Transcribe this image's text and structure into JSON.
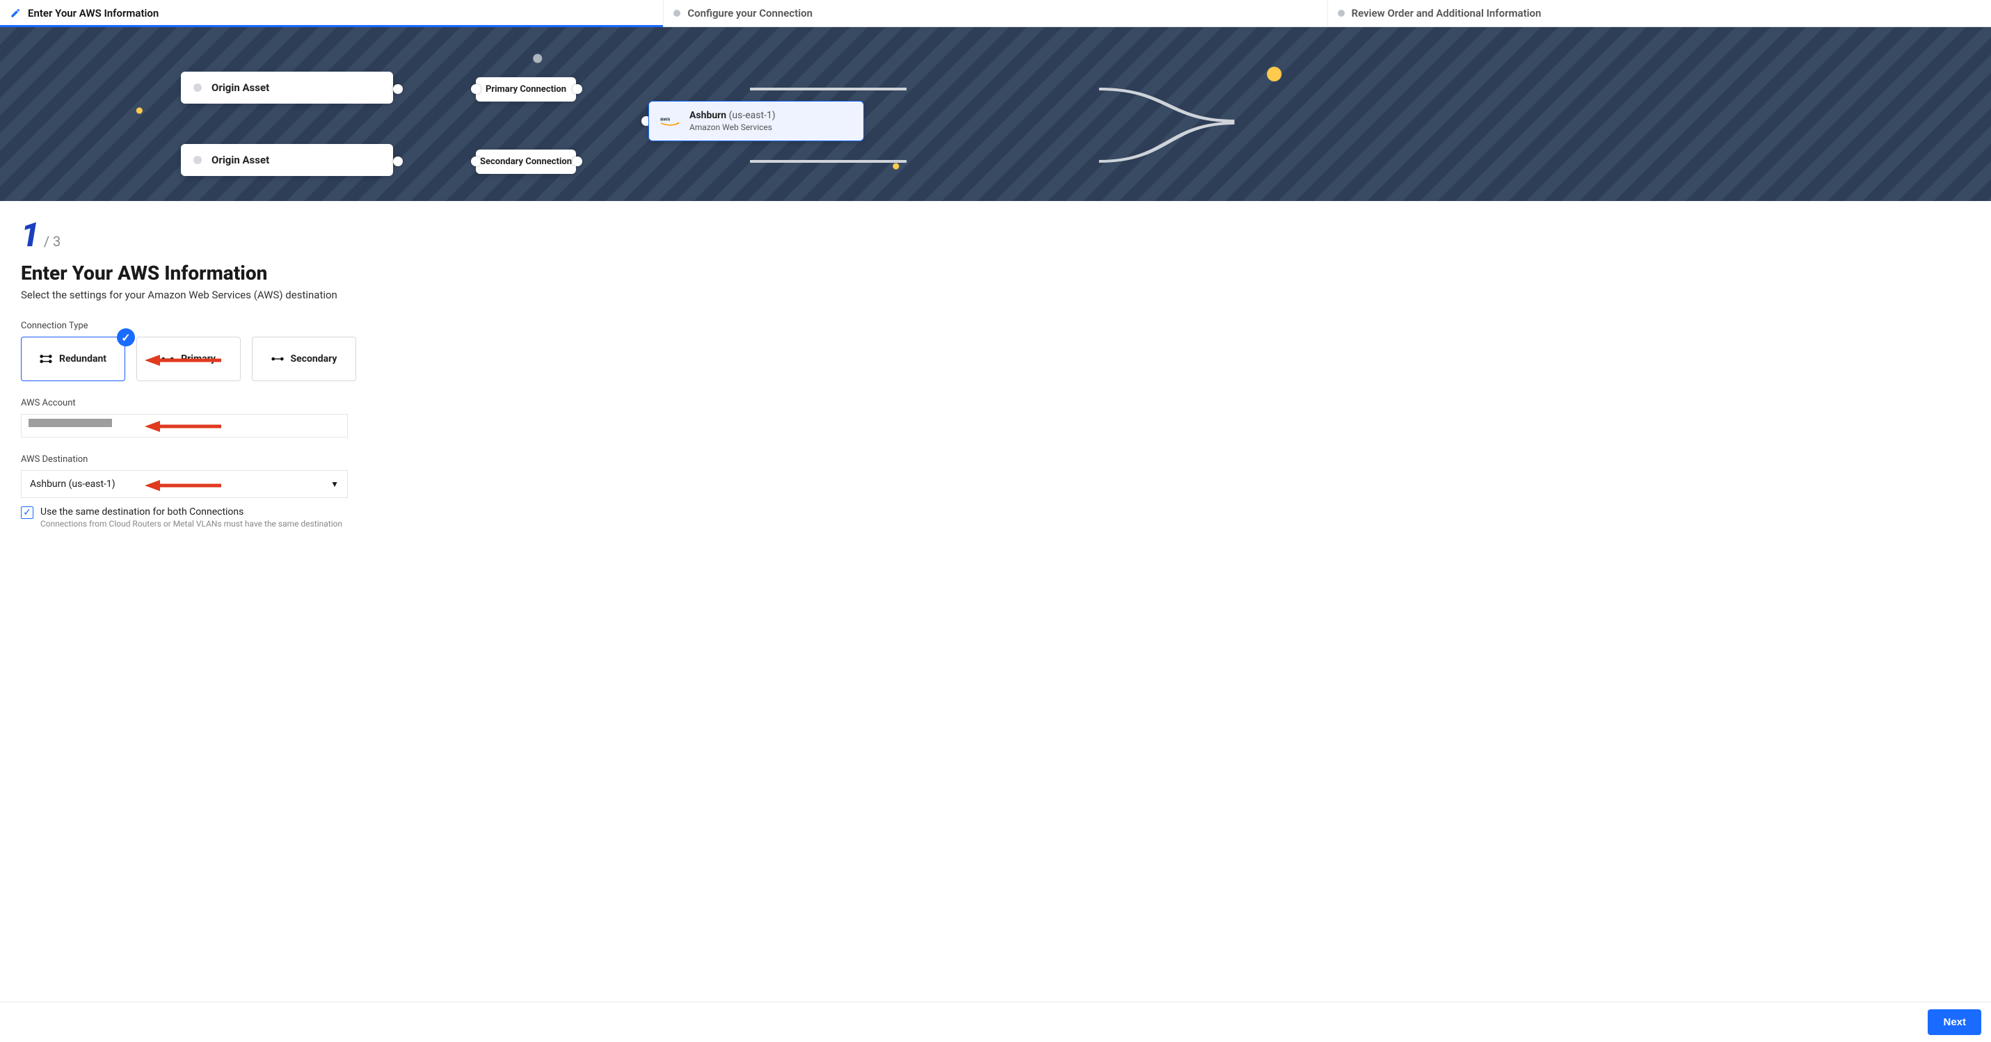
{
  "stepper": {
    "active_index": 0,
    "steps": [
      "Enter Your AWS Information",
      "Configure your Connection",
      "Review Order and Additional Information"
    ]
  },
  "progress": {
    "current": "1",
    "total": "/ 3"
  },
  "page": {
    "title": "Enter Your AWS Information",
    "subtitle": "Select the settings for your Amazon Web Services (AWS) destination"
  },
  "topology": {
    "origin1": "Origin Asset",
    "origin2": "Origin Asset",
    "primary": "Primary Connection",
    "secondary": "Secondary Connection",
    "dest_name": "Ashburn",
    "dest_region": "(us-east-1)",
    "dest_provider": "Amazon Web Services"
  },
  "sections": {
    "connection_type_label": "Connection Type",
    "connection_types": [
      "Redundant",
      "Primary",
      "Secondary"
    ],
    "connection_type_selected": "Redundant",
    "aws_account_label": "AWS Account",
    "aws_account_value": "",
    "aws_destination_label": "AWS Destination",
    "aws_destination_value": "Ashburn (us-east-1)",
    "same_destination_checked": true,
    "same_destination_label": "Use the same destination for both Connections",
    "same_destination_help": "Connections from Cloud Routers or Metal VLANs must have the same destination"
  },
  "footer": {
    "next": "Next"
  }
}
